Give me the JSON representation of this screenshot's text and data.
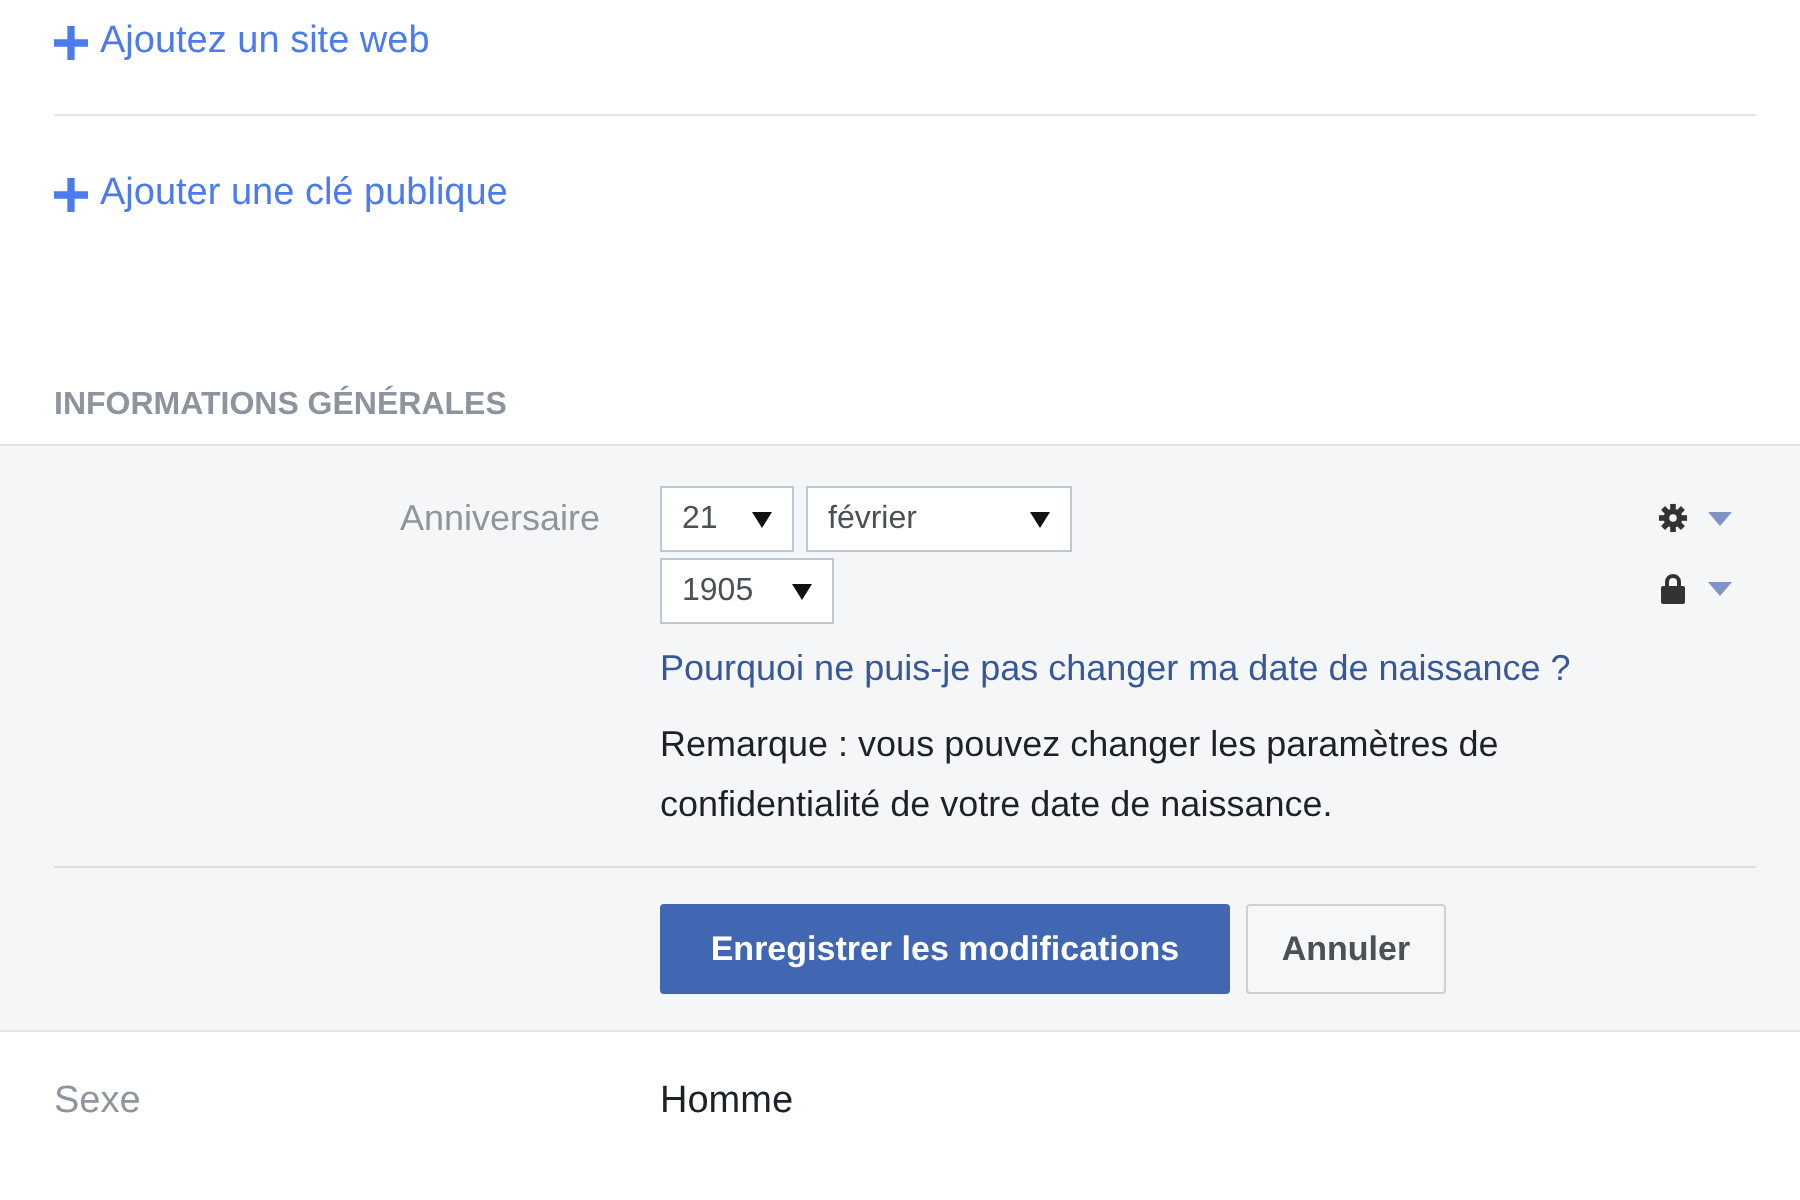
{
  "add_links": [
    {
      "label": "Ajoutez un site web"
    },
    {
      "label": "Ajouter une clé publique"
    }
  ],
  "section": {
    "title": "INFORMATIONS GÉNÉRALES"
  },
  "birthday": {
    "label": "Anniversaire",
    "selects": [
      {
        "value": "21"
      },
      {
        "value": "février"
      },
      {
        "value": "1905"
      }
    ],
    "link": "Pourquoi ne puis-je pas changer ma date de naissance ?",
    "note": "Remarque : vous pouvez changer les paramètres de confidentialité de votre date de naissance.",
    "buttons": [
      {
        "label": "Enregistrer les modifications",
        "kind": "primary"
      },
      {
        "label": "Annuler",
        "kind": "secondary"
      }
    ]
  },
  "gender": {
    "label": "Sexe",
    "value": "Homme"
  }
}
